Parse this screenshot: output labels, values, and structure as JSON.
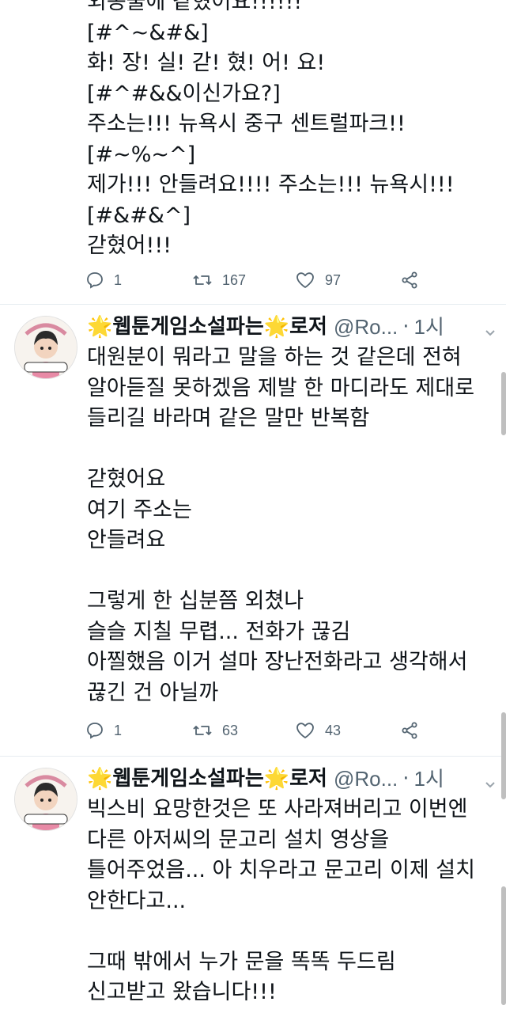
{
  "tweet0": {
    "lines": [
      "외동물에 같혔어요!!!!!!",
      "[#^~&#&]",
      "화! 장! 실! 갇! 혔! 어! 요!",
      "[#^#&&이신가요?]",
      "주소는!!! 뉴욕시 중구 센트럴파크!!",
      "[#~%~^]",
      "제가!!! 안들려요!!!! 주소는!!! 뉴욕시!!!",
      "[#&#&^]",
      "갇혔어!!!"
    ],
    "replies": "1",
    "retweets": "167",
    "likes": "97"
  },
  "tweet1": {
    "star": "🌟",
    "name_part1": "웹툰게임소설파는",
    "name_part2": "로저",
    "handle": "@Ro...",
    "dot": "·",
    "time": "1시",
    "text": "대원분이 뭐라고 말을 하는 것 같은데 전혀\n알아듣질 못하겠음 제발 한 마디라도 제대로\n들리길 바라며 같은 말만 반복함\n\n갇혔어요\n여기 주소는\n안들려요\n\n그렇게 한 십분쯤 외쳤나\n슬슬 지칠 무렵... 전화가 끊김\n아찔했음 이거 설마 장난전화라고 생각해서\n끊긴 건 아닐까",
    "replies": "1",
    "retweets": "63",
    "likes": "43"
  },
  "tweet2": {
    "star": "🌟",
    "name_part1": "웹툰게임소설파는",
    "name_part2": "로저",
    "handle": "@Ro...",
    "dot": "·",
    "time": "1시",
    "text": "빅스비 요망한것은 또 사라져버리고 이번엔\n다른 아저씨의 문고리 설치 영상을\n틀어주었음... 아 치우라고 문고리 이제 설치\n안한다고...\n\n그때 밖에서 누가 문을 똑똑 두드림\n신고받고 왔습니다!!!"
  },
  "colors": {
    "muted": "#536471",
    "star": "#f5a623",
    "divider": "#e6ecf0"
  }
}
